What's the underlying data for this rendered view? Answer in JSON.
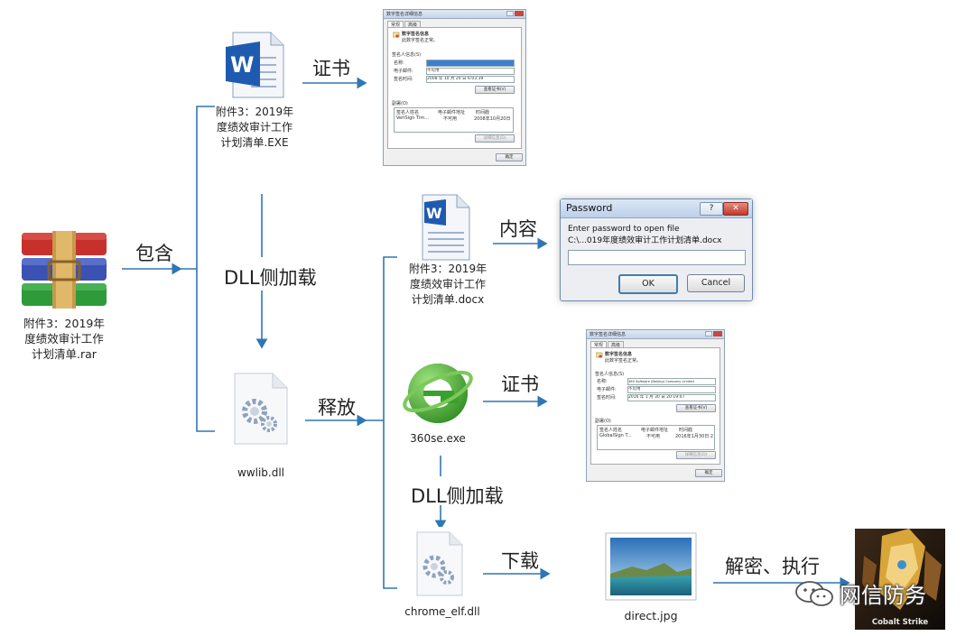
{
  "nodes": {
    "rar": {
      "caption": "附件3：2019年\n度绩效审计工作\n计划清单.rar",
      "icon": "winrar-archive-icon"
    },
    "exe": {
      "caption": "附件3：2019年\n度绩效审计工作\n计划清单.EXE",
      "icon": "word-document-icon"
    },
    "wwlib": {
      "caption": "wwlib.dll",
      "icon": "dll-gear-icon"
    },
    "docx": {
      "caption": "附件3：2019年\n度绩效审计工作\n计划清单.docx",
      "icon": "word-document-icon"
    },
    "se360": {
      "caption": "360se.exe",
      "icon": "360-browser-icon"
    },
    "chrome_elf": {
      "caption": "chrome_elf.dll",
      "icon": "dll-gear-icon"
    },
    "direct": {
      "caption": "direct.jpg",
      "icon": "image-file-icon"
    },
    "cobalt": {
      "caption": "Cobalt Strike",
      "icon": "cobalt-strike-logo"
    }
  },
  "edges": {
    "contains": "包含",
    "dll_sideload_1": "DLL侧加载",
    "release": "释放",
    "cert_1": "证书",
    "content": "内容",
    "cert_2": "证书",
    "dll_sideload_2": "DLL侧加载",
    "download": "下载",
    "decrypt_exec": "解密、执行"
  },
  "cert_dialog_1": {
    "title": "数字签名详细信息",
    "tabs": [
      "常规",
      "高级"
    ],
    "heading": "数字签名信息",
    "status": "此数字签名正常。",
    "signer_section": "签名人信息(S)",
    "name_label": "名称:",
    "email_label": "电子邮件:",
    "email_value": "不可用",
    "time_label": "签名时间:",
    "time_value": "2008 年 10 月 20 日 6:03:39",
    "view_cert_button": "查看证书(V)",
    "countersig_section": "副署(O)",
    "table_headers": [
      "签名人姓名",
      "电子邮件地址",
      "时间戳"
    ],
    "table_row": [
      "VeriSign Tim...",
      "不可用",
      "2008年10月20日"
    ],
    "details_button": "详细信息(D)",
    "ok_button": "确定"
  },
  "cert_dialog_2": {
    "title": "数字签名详细信息",
    "tabs": [
      "常规",
      "高级"
    ],
    "heading": "数字签名信息",
    "status": "此数字签名正常。",
    "signer_section": "签名人信息(S)",
    "name_label": "名称:",
    "name_value": "360 Software (Beijing) Company Limited",
    "email_label": "电子邮件:",
    "email_value": "不可用",
    "time_label": "签名时间:",
    "time_value": "2016 年 1 月 30 日 20:19:07",
    "view_cert_button": "查看证书(V)",
    "countersig_section": "副署(O)",
    "table_headers": [
      "签名人姓名",
      "电子邮件地址",
      "时间戳"
    ],
    "table_row": [
      "GlobalSign T...",
      "不可用",
      "2016年1月30日 2"
    ],
    "details_button": "详细信息(D)",
    "ok_button": "确定"
  },
  "password_dialog": {
    "title": "Password",
    "help_glyph": "?",
    "close_glyph": "✕",
    "prompt": "Enter password to open file",
    "path": "C:\\...019年度绩效审计工作计划清单.docx",
    "input_value": "",
    "ok": "OK",
    "cancel": "Cancel"
  },
  "watermark": {
    "text": "网信防务",
    "icon": "wechat-icon"
  },
  "colors": {
    "arrow": "#2e77b4",
    "word_blue": "#1e5bb0",
    "ie_green": "#3aa02c"
  }
}
